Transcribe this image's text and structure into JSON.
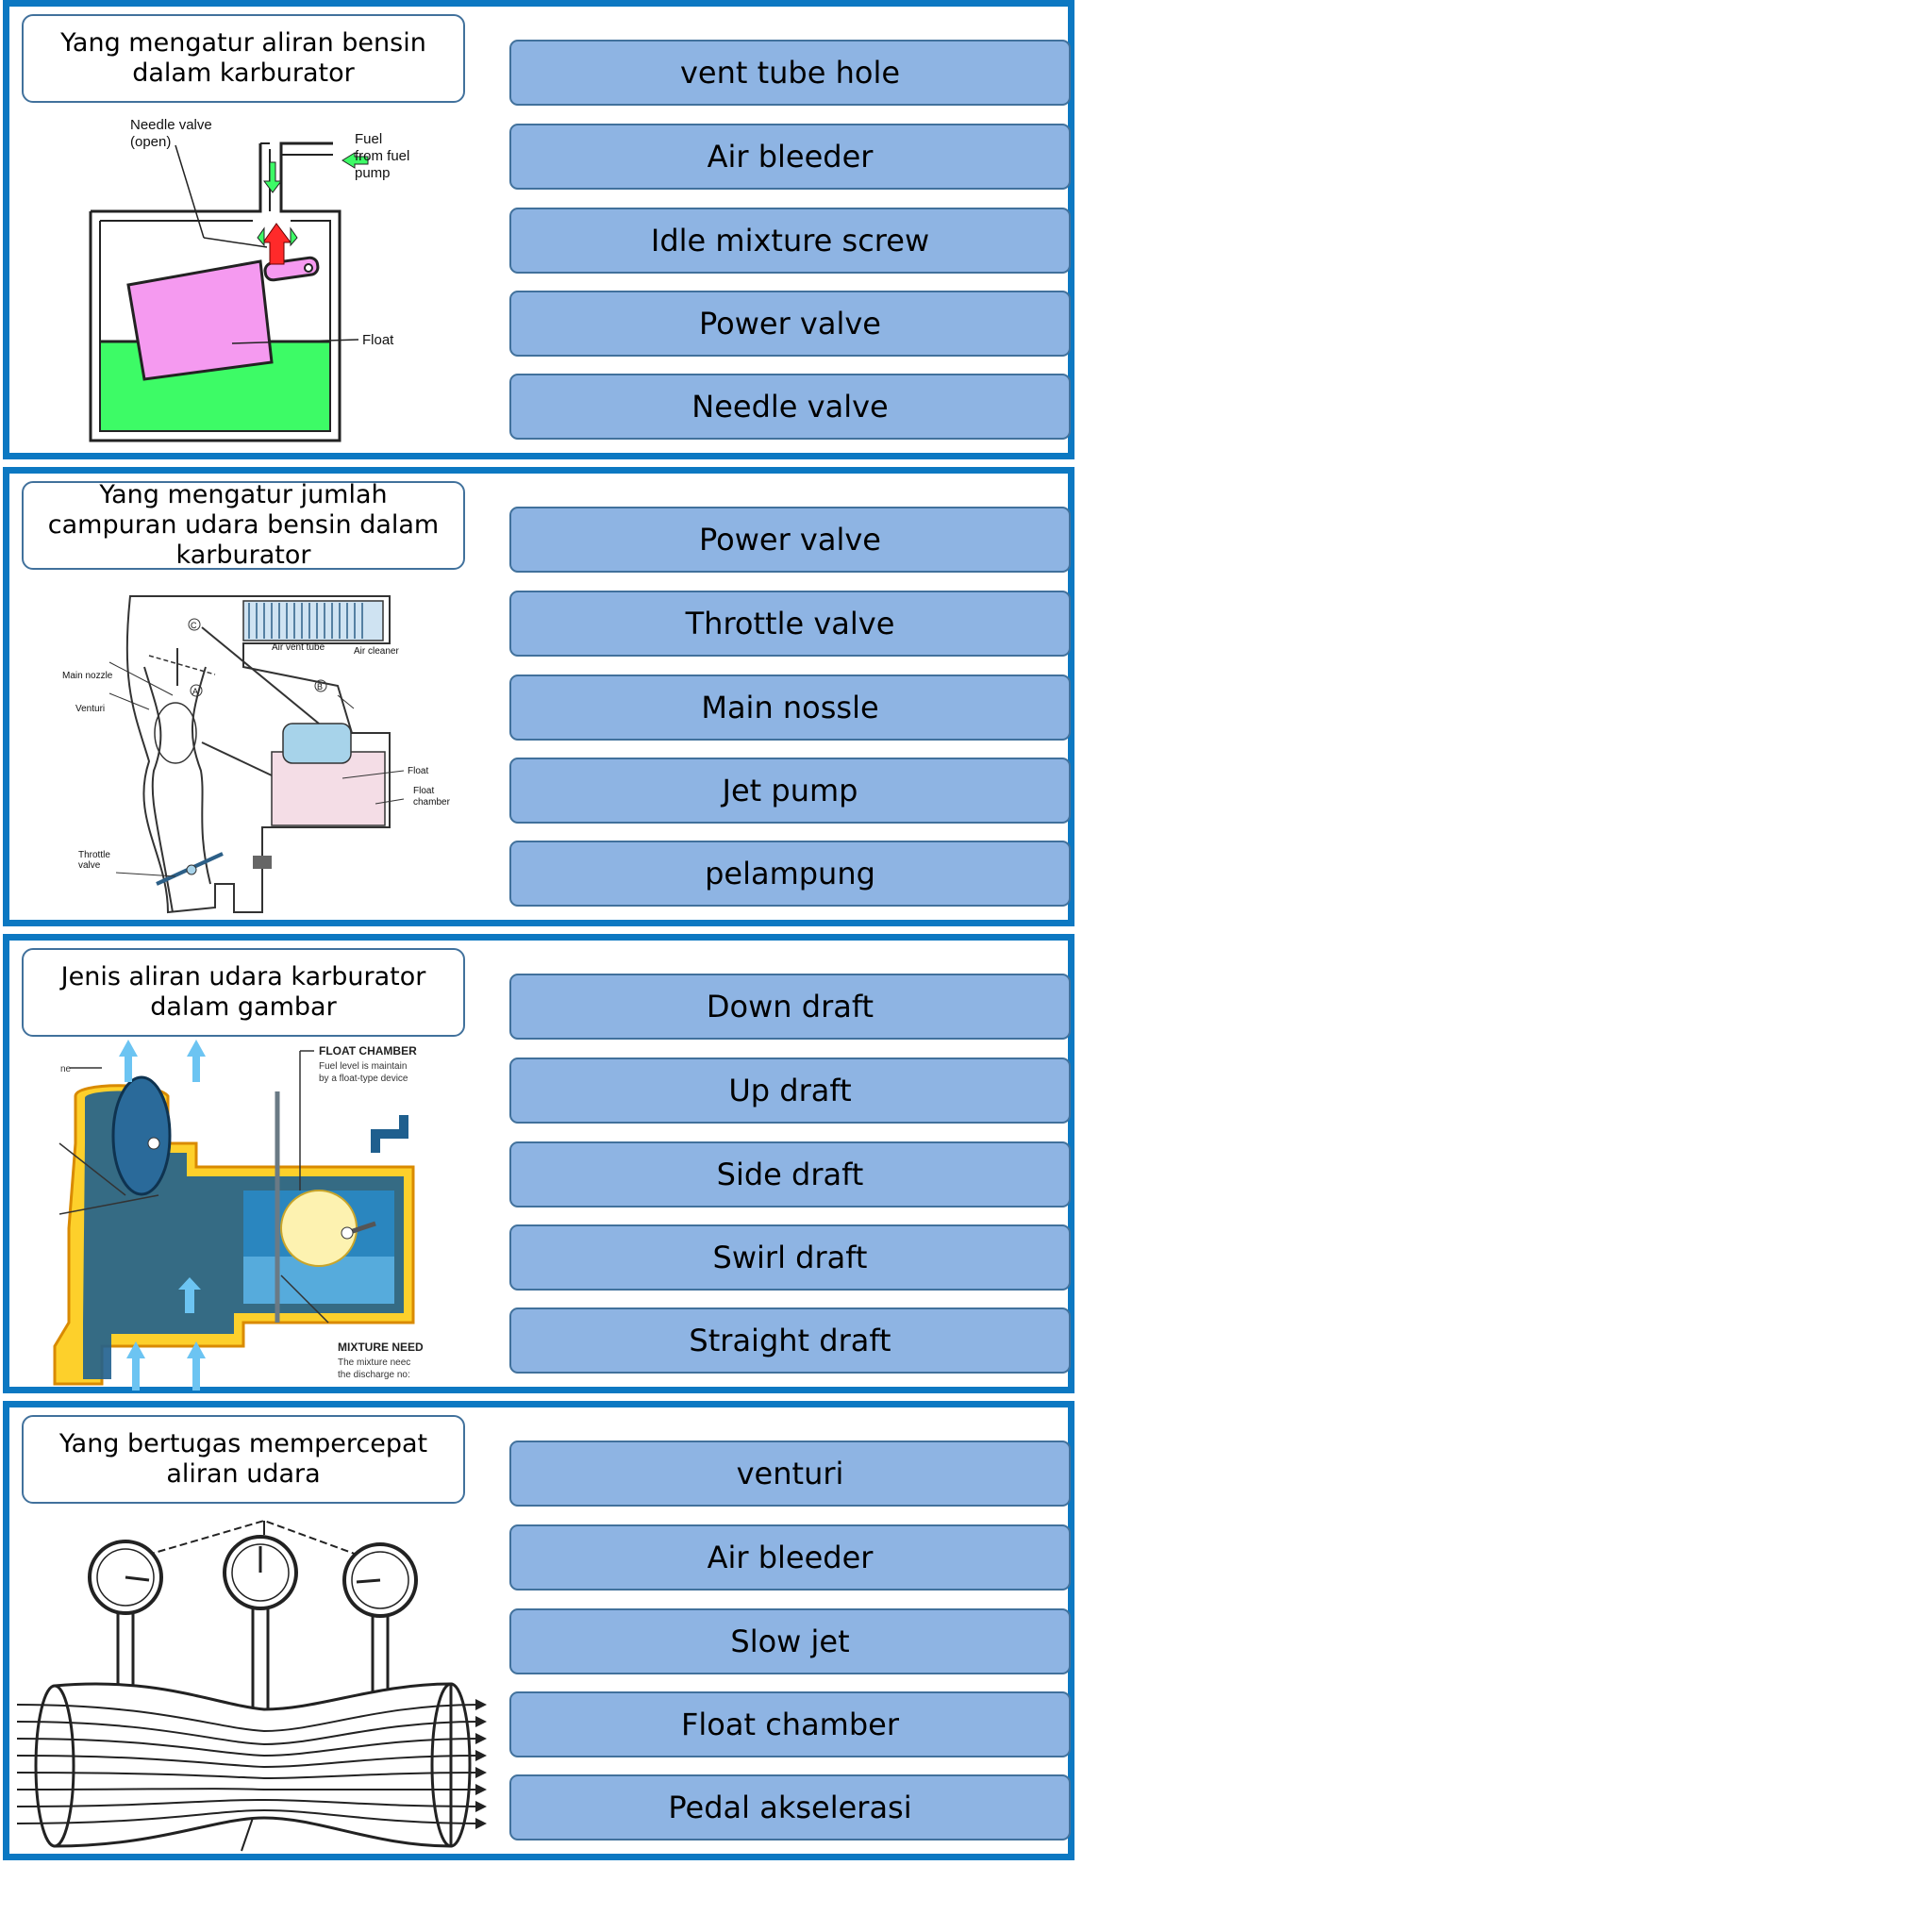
{
  "questions": [
    {
      "prompt": "Yang mengatur aliran bensin dalam karburator",
      "labels": {
        "needle": "Needle valve",
        "open": "(open)",
        "fuel1": "Fuel",
        "fuel2": "from fuel",
        "fuel3": "pump",
        "float": "Float"
      },
      "options": [
        "vent tube hole",
        "Air bleeder",
        "Idle mixture screw",
        "Power valve",
        "Needle valve"
      ]
    },
    {
      "prompt": "Yang mengatur jumlah campuran udara bensin dalam karburator",
      "labels": {
        "air_vent_tube": "Air vent tube",
        "air_cleaner": "Air cleaner",
        "main_nozzle": "Main nozzle",
        "venturi": "Venturi",
        "float": "Float",
        "float_chamber1": "Float",
        "float_chamber2": "chamber",
        "throttle1": "Throttle",
        "throttle2": "valve",
        "a": "A",
        "b": "B",
        "c": "C"
      },
      "options": [
        "Power valve",
        "Throttle valve",
        "Main nossle",
        "Jet pump",
        "pelampung"
      ]
    },
    {
      "prompt": "Jenis aliran udara karburator dalam gambar",
      "labels": {
        "float_chamber": "FLOAT CHAMBER",
        "fc_line1": "Fuel level is maintain",
        "fc_line2": "by a float-type device",
        "mixture": "MIXTURE NEED",
        "mx_line1": "The mixture neec",
        "mx_line2": "the discharge no:",
        "ne": "ne"
      },
      "options": [
        "Down draft",
        "Up draft",
        "Side draft",
        "Swirl draft",
        "Straight draft"
      ]
    },
    {
      "prompt": "Yang bertugas mempercepat aliran udara",
      "labels": {},
      "options": [
        "venturi",
        "Air bleeder",
        "Slow jet",
        "Float chamber",
        "Pedal akselerasi"
      ]
    }
  ],
  "colors": {
    "frame": "#0c78c2",
    "option_fill": "#8eb4e3",
    "option_border": "#41719c",
    "float_pink": "#f59af0",
    "fuel_green": "#3dfb66"
  }
}
